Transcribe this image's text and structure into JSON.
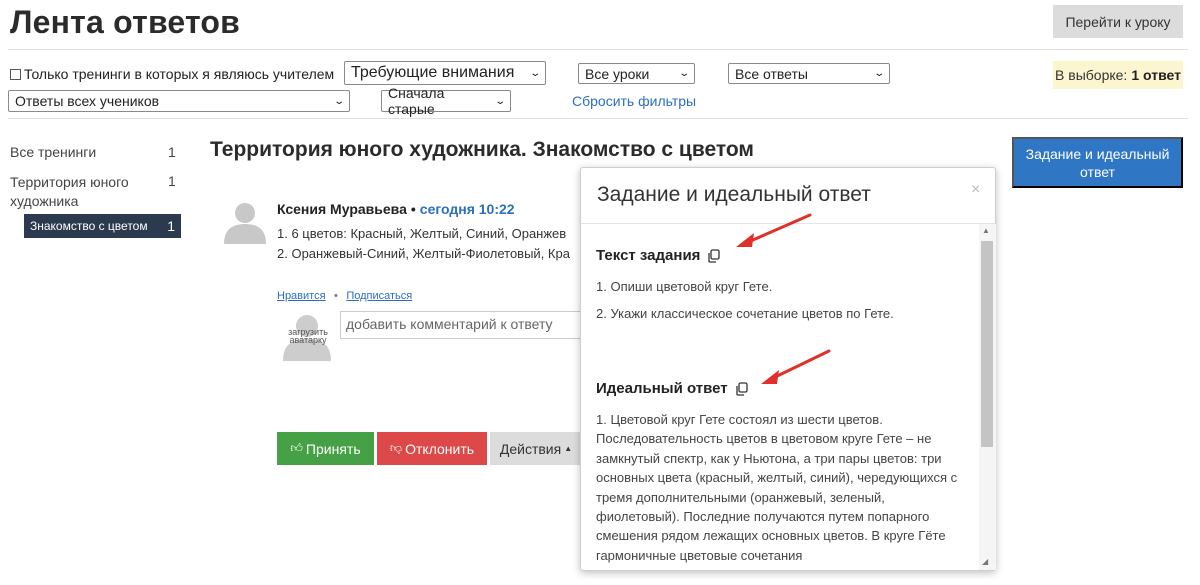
{
  "header": {
    "title": "Лента ответов",
    "goto_button": "Перейти к уроку"
  },
  "filters": {
    "teacher_only_label": "Только тренинги в которых я являюсь учителем",
    "status_select": "Требующие внимания",
    "lessons_select": "Все уроки",
    "answers_select": "Все ответы",
    "students_select": "Ответы всех учеников",
    "order_select": "Сначала старые",
    "reset_link": "Сбросить фильтры",
    "count_label": "В выборке:",
    "count_value": "1 ответ"
  },
  "sidebar": {
    "items": [
      {
        "label": "Все тренинги",
        "count": "1"
      },
      {
        "label_line1": "Территория юного",
        "label_line2": "художника",
        "count": "1"
      },
      {
        "label": "Знакомство с цветом",
        "count": "1"
      }
    ]
  },
  "main": {
    "title": "Территория юного художника. Знакомство с цветом",
    "author": "Ксения Муравьева",
    "separator": "•",
    "time": "сегодня 10:22",
    "answer_line1": "1. 6 цветов: Красный, Желтый, Синий, Оранжев",
    "answer_line2": "2. Оранжевый-Синий, Желтый-Фиолетовый, Кра",
    "like_link": "Нравится",
    "link_dot": "•",
    "subscribe_link": "Подписаться",
    "upload_avatar_line1": "загрузить",
    "upload_avatar_line2": "аватарку",
    "comment_placeholder": "добавить комментарий к ответу",
    "accept_button": "Принять",
    "reject_button": "Отклонить",
    "actions_button": "Действия"
  },
  "task_button": "Задание и идеальный ответ",
  "modal": {
    "title": "Задание и идеальный ответ",
    "close": "×",
    "task_heading": "Текст задания",
    "task_line1": "1. Опиши цветовой круг Гете.",
    "task_line2": "2. Укажи классическое сочетание цветов по Гете.",
    "ideal_heading": "Идеальный ответ",
    "ideal_text": "1. Цветовой круг Гете состоял из шести цветов. Последовательность цветов в цветовом круге Гете – не замкнутый спектр, как у Ньютона, а три пары цветов: три основных цвета (красный, желтый, синий), чередующихся с тремя дополнительными (оранжевый, зеленый, фиолетовый). Последние получаются путем попарного смешения рядом лежащих основных цветов. В круге Гёте гармоничные цветовые сочетания"
  },
  "colors": {
    "accent_blue": "#2f76c4",
    "accept_green": "#45a046",
    "reject_red": "#dd4848",
    "sidebar_active": "#2b3a4f",
    "annotation_arrow": "#e0302a"
  },
  "icons": {
    "thumb_up": "thumbs-up-icon",
    "thumb_down": "thumbs-down-icon",
    "copy": "copy-icon",
    "avatar": "avatar-icon",
    "caret": "caret-up-icon"
  }
}
